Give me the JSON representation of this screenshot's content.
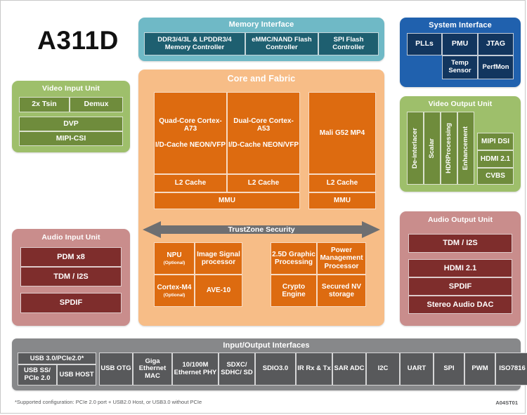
{
  "chip": {
    "name": "A311D"
  },
  "memory_interface": {
    "title": "Memory Interface",
    "blocks": [
      "DDR3/4/3L & LPDDR3/4 Memory Controller",
      "eMMC/NAND Flash Controller",
      "SPI Flash Controller"
    ]
  },
  "system_interface": {
    "title": "System Interface",
    "blocks": [
      "PLLs",
      "PMU",
      "JTAG",
      "Temp Sensor",
      "PerfMon"
    ]
  },
  "video_input_unit": {
    "title": "Video Input Unit",
    "blocks": [
      "2x Tsin",
      "Demux",
      "DVP",
      "MIPI-CSI"
    ]
  },
  "video_output_unit": {
    "title": "Video Output Unit",
    "vertical_blocks": [
      "De-interlacer",
      "Scalar",
      "HDRProcessing",
      "Enhancement"
    ],
    "output_blocks": [
      "MIPI DSI",
      "HDMI 2.1",
      "CVBS"
    ]
  },
  "audio_input_unit": {
    "title": "Audio Input Unit",
    "blocks": [
      "PDM x8",
      "TDM / I2S",
      "SPDIF"
    ]
  },
  "audio_output_unit": {
    "title": "Audio Output Unit",
    "blocks": [
      "TDM / I2S",
      "HDMI 2.1",
      "SPDIF",
      "Stereo Audio DAC"
    ]
  },
  "core_and_fabric": {
    "title": "Core and Fabric",
    "cpu_cluster_1": {
      "core": "Quad-Core Cortex-A73",
      "features": "I/D-Cache NEON/VFP",
      "l2": "L2 Cache"
    },
    "cpu_cluster_2": {
      "core": "Dual-Core Cortex-A53",
      "features": "I/D-Cache NEON/VFP",
      "l2": "L2 Cache"
    },
    "cpu_mmu": "MMU",
    "gpu": {
      "name": "Mali G52 MP4",
      "l2": "L2 Cache",
      "mmu": "MMU"
    },
    "trustzone": "TrustZone Security",
    "accelerators_left": [
      {
        "label": "NPU",
        "note": "(Optional)"
      },
      {
        "label": "Image Signal processor",
        "note": ""
      },
      {
        "label": "Cortex-M4",
        "note": "(Optional)"
      },
      {
        "label": "AVE-10",
        "note": ""
      }
    ],
    "accelerators_right": [
      {
        "label": "2.5D Graphic Processing",
        "note": ""
      },
      {
        "label": "Power Management Processor",
        "note": ""
      },
      {
        "label": "Crypto Engine",
        "note": ""
      },
      {
        "label": "Secured NV storage",
        "note": ""
      }
    ]
  },
  "io_interfaces": {
    "title": "Input/Output Interfaces",
    "usb_group_header": "USB 3.0/PCIe2.0*",
    "usb_group_cells": [
      "USB SS/ PCIe 2.0",
      "USB HOST"
    ],
    "blocks": [
      "USB OTG",
      "Giga Ethernet MAC",
      "10/100M Ethernet PHY",
      "SDXC/ SDHC/ SD",
      "SDIO3.0",
      "IR Rx & Tx",
      "SAR ADC",
      "I2C",
      "UART",
      "SPI",
      "PWM",
      "ISO7816"
    ]
  },
  "footer": {
    "footnote": "*Supported configuration: PCIe 2.0 port + USB2.0 Host, or USB3.0 without PCIe",
    "doc_code": "A04ST01"
  },
  "colors": {
    "memory": "#1e5f70",
    "memory_bg": "#6fb9c6",
    "system": "#12365f",
    "system_bg": "#2061ae",
    "video": "#6f8c3c",
    "video_bg": "#9ebf6b",
    "audio": "#7e2d2c",
    "audio_bg": "#c98d8c",
    "core": "#dd6b10",
    "core_bg": "#f7bd87",
    "io": "#58595b",
    "io_bg": "#87888a"
  }
}
